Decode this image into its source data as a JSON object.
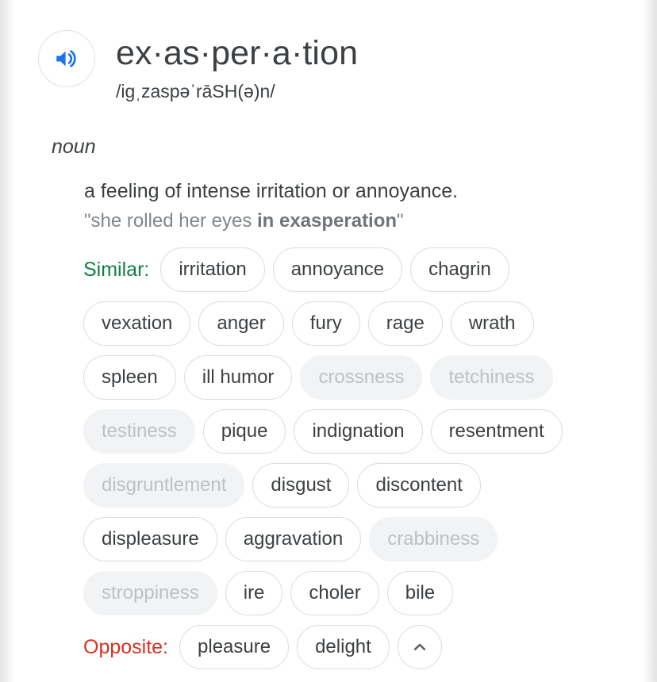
{
  "entry": {
    "headword": "ex·as·per·a·tion",
    "phonetic": "/igˌzaspəˈrāSH(ə)n/",
    "part_of_speech": "noun",
    "definition": "a feeling of intense irritation or annoyance.",
    "example_quote_open": "\"",
    "example_text": "she rolled her eyes ",
    "example_bold": "in exasperation",
    "example_quote_close": "\"",
    "audio_icon": "speaker-icon",
    "audio_icon_color": "#1a73e8"
  },
  "thesaurus": {
    "similar_label": "Similar:",
    "similar_label_color": "#0f8043",
    "opposite_label": "Opposite:",
    "opposite_label_color": "#d93025",
    "collapse_icon": "chevron-up-icon",
    "rows": [
      {
        "label": "Similar:",
        "label_kind": "similar",
        "chips": [
          {
            "text": "irritation",
            "muted": false
          },
          {
            "text": "annoyance",
            "muted": false
          },
          {
            "text": "chagrin",
            "muted": false
          }
        ]
      },
      {
        "label": "",
        "label_kind": "none",
        "chips": [
          {
            "text": "vexation",
            "muted": false
          },
          {
            "text": "anger",
            "muted": false
          },
          {
            "text": "fury",
            "muted": false
          },
          {
            "text": "rage",
            "muted": false
          },
          {
            "text": "wrath",
            "muted": false
          }
        ]
      },
      {
        "label": "",
        "label_kind": "none",
        "chips": [
          {
            "text": "spleen",
            "muted": false
          },
          {
            "text": "ill humor",
            "muted": false
          },
          {
            "text": "crossness",
            "muted": true
          },
          {
            "text": "tetchiness",
            "muted": true
          }
        ]
      },
      {
        "label": "",
        "label_kind": "none",
        "chips": [
          {
            "text": "testiness",
            "muted": true
          },
          {
            "text": "pique",
            "muted": false
          },
          {
            "text": "indignation",
            "muted": false
          },
          {
            "text": "resentment",
            "muted": false
          }
        ]
      },
      {
        "label": "",
        "label_kind": "none",
        "chips": [
          {
            "text": "disgruntlement",
            "muted": true
          },
          {
            "text": "disgust",
            "muted": false
          },
          {
            "text": "discontent",
            "muted": false
          }
        ]
      },
      {
        "label": "",
        "label_kind": "none",
        "chips": [
          {
            "text": "displeasure",
            "muted": false
          },
          {
            "text": "aggravation",
            "muted": false
          },
          {
            "text": "crabbiness",
            "muted": true
          }
        ]
      },
      {
        "label": "",
        "label_kind": "none",
        "chips": [
          {
            "text": "stroppiness",
            "muted": true
          },
          {
            "text": "ire",
            "muted": false
          },
          {
            "text": "choler",
            "muted": false
          },
          {
            "text": "bile",
            "muted": false
          }
        ]
      },
      {
        "label": "Opposite:",
        "label_kind": "opposite",
        "chips": [
          {
            "text": "pleasure",
            "muted": false
          },
          {
            "text": "delight",
            "muted": false
          }
        ],
        "has_collapse": true
      }
    ]
  }
}
